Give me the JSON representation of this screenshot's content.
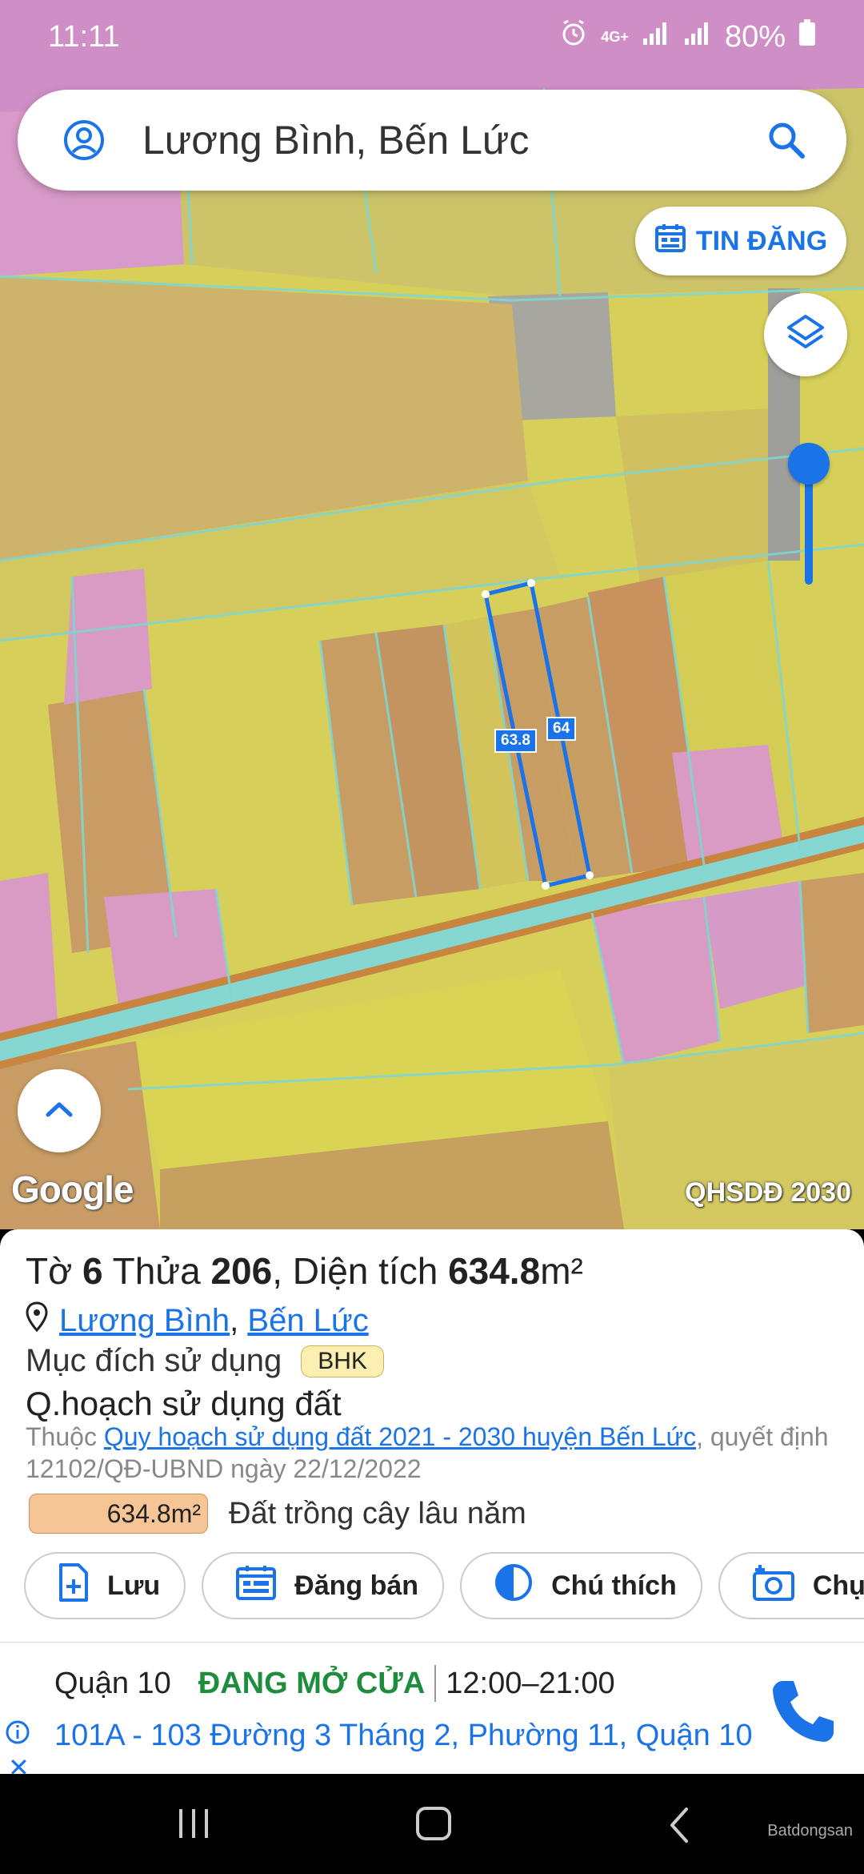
{
  "status": {
    "time": "11:11",
    "network": "4G+",
    "battery": "80%"
  },
  "search": {
    "query": "Lương Bình, Bến Lức"
  },
  "buttons": {
    "tin_dang": "TIN ĐĂNG"
  },
  "map": {
    "provider": "Google",
    "layer_label": "QHSDĐ 2030",
    "plot_side_a": "63.8",
    "plot_side_b": "64",
    "watermark": "Batdongsan",
    "colors": {
      "land_yellow": "#d8d257",
      "land_orange": "#c89a63",
      "land_pink": "#d190c9",
      "road_cyan": "#7fd6d0",
      "plot_outline": "#1a73e8"
    }
  },
  "parcel": {
    "to_label": "Tờ",
    "to_value": "6",
    "thua_label": "Thửa",
    "thua_value": "206",
    "area_label": "Diện tích",
    "area_value": "634.8",
    "area_unit": "m²",
    "ward": "Lương Bình",
    "district": "Bến Lức",
    "purpose_label": "Mục đích sử dụng",
    "purpose_code": "BHK",
    "plan_title": "Q.hoạch sử dụng đất",
    "plan_prefix": "Thuộc",
    "plan_link": "Quy hoạch sử dụng đất 2021 - 2030 huyện Bến Lức",
    "plan_suffix": ", quyết định 12102/QĐ-UBND ngày 22/12/2022",
    "chip_area": "634.8m²",
    "chip_desc": "Đất trồng cây lâu năm"
  },
  "actions": [
    {
      "label": "Lưu",
      "icon": "add-file-icon"
    },
    {
      "label": "Đăng bán",
      "icon": "listing-icon"
    },
    {
      "label": "Chú thích",
      "icon": "contrast-icon"
    },
    {
      "label": "Chụp",
      "icon": "camera-plus-icon"
    }
  ],
  "ad": {
    "name": "Quận 10",
    "status": "ĐANG MỞ CỬA",
    "hours": "12:00–21:00",
    "address": "101A - 103 Đường 3 Tháng 2, Phường 11, Quận 10"
  },
  "watermark": "Batdongsan"
}
